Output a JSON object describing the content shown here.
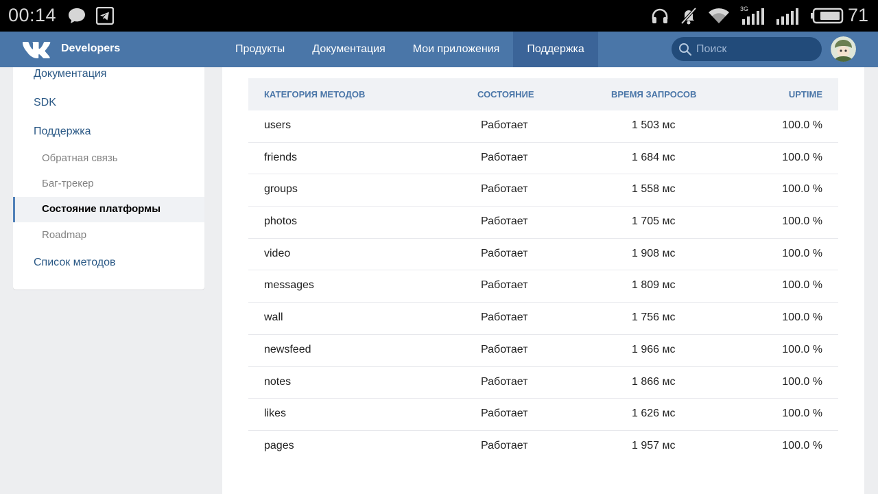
{
  "status_bar": {
    "time": "00:14",
    "network": "3G",
    "battery": "71",
    "icons": [
      "chat-bubble-icon",
      "telegram-icon",
      "headphones-icon",
      "mute-icon",
      "wifi-icon",
      "signal-icon",
      "battery-icon"
    ]
  },
  "header": {
    "brand": "Developers",
    "nav": [
      {
        "label": "Продукты"
      },
      {
        "label": "Документация"
      },
      {
        "label": "Мои приложения"
      },
      {
        "label": "Поддержка"
      }
    ],
    "active_nav": "Поддержка",
    "search_placeholder": "Поиск"
  },
  "sidebar": {
    "items": [
      {
        "label": "Документация"
      },
      {
        "label": "SDK"
      },
      {
        "label": "Поддержка"
      }
    ],
    "subitems": [
      {
        "label": "Обратная связь"
      },
      {
        "label": "Баг-трекер"
      },
      {
        "label": "Состояние платформы"
      },
      {
        "label": "Roadmap"
      }
    ],
    "active_subitem": "Состояние платформы",
    "bottom_item": "Список методов"
  },
  "table": {
    "headers": [
      "КАТЕГОРИЯ МЕТОДОВ",
      "СОСТОЯНИЕ",
      "ВРЕМЯ ЗАПРОСОВ",
      "UPTIME"
    ],
    "rows": [
      [
        "users",
        "Работает",
        "1 503 мс",
        "100.0 %"
      ],
      [
        "friends",
        "Работает",
        "1 684 мс",
        "100.0 %"
      ],
      [
        "groups",
        "Работает",
        "1 558 мс",
        "100.0 %"
      ],
      [
        "photos",
        "Работает",
        "1 705 мс",
        "100.0 %"
      ],
      [
        "video",
        "Работает",
        "1 908 мс",
        "100.0 %"
      ],
      [
        "messages",
        "Работает",
        "1 809 мс",
        "100.0 %"
      ],
      [
        "wall",
        "Работает",
        "1 756 мс",
        "100.0 %"
      ],
      [
        "newsfeed",
        "Работает",
        "1 966 мс",
        "100.0 %"
      ],
      [
        "notes",
        "Работает",
        "1 866 мс",
        "100.0 %"
      ],
      [
        "likes",
        "Работает",
        "1 626 мс",
        "100.0 %"
      ],
      [
        "pages",
        "Работает",
        "1 957 мс",
        "100.0 %"
      ]
    ]
  },
  "colors": {
    "header_bg": "#4a76a8",
    "accent": "#5181b8",
    "link": "#2a5885",
    "page_bg": "#edeef0"
  }
}
